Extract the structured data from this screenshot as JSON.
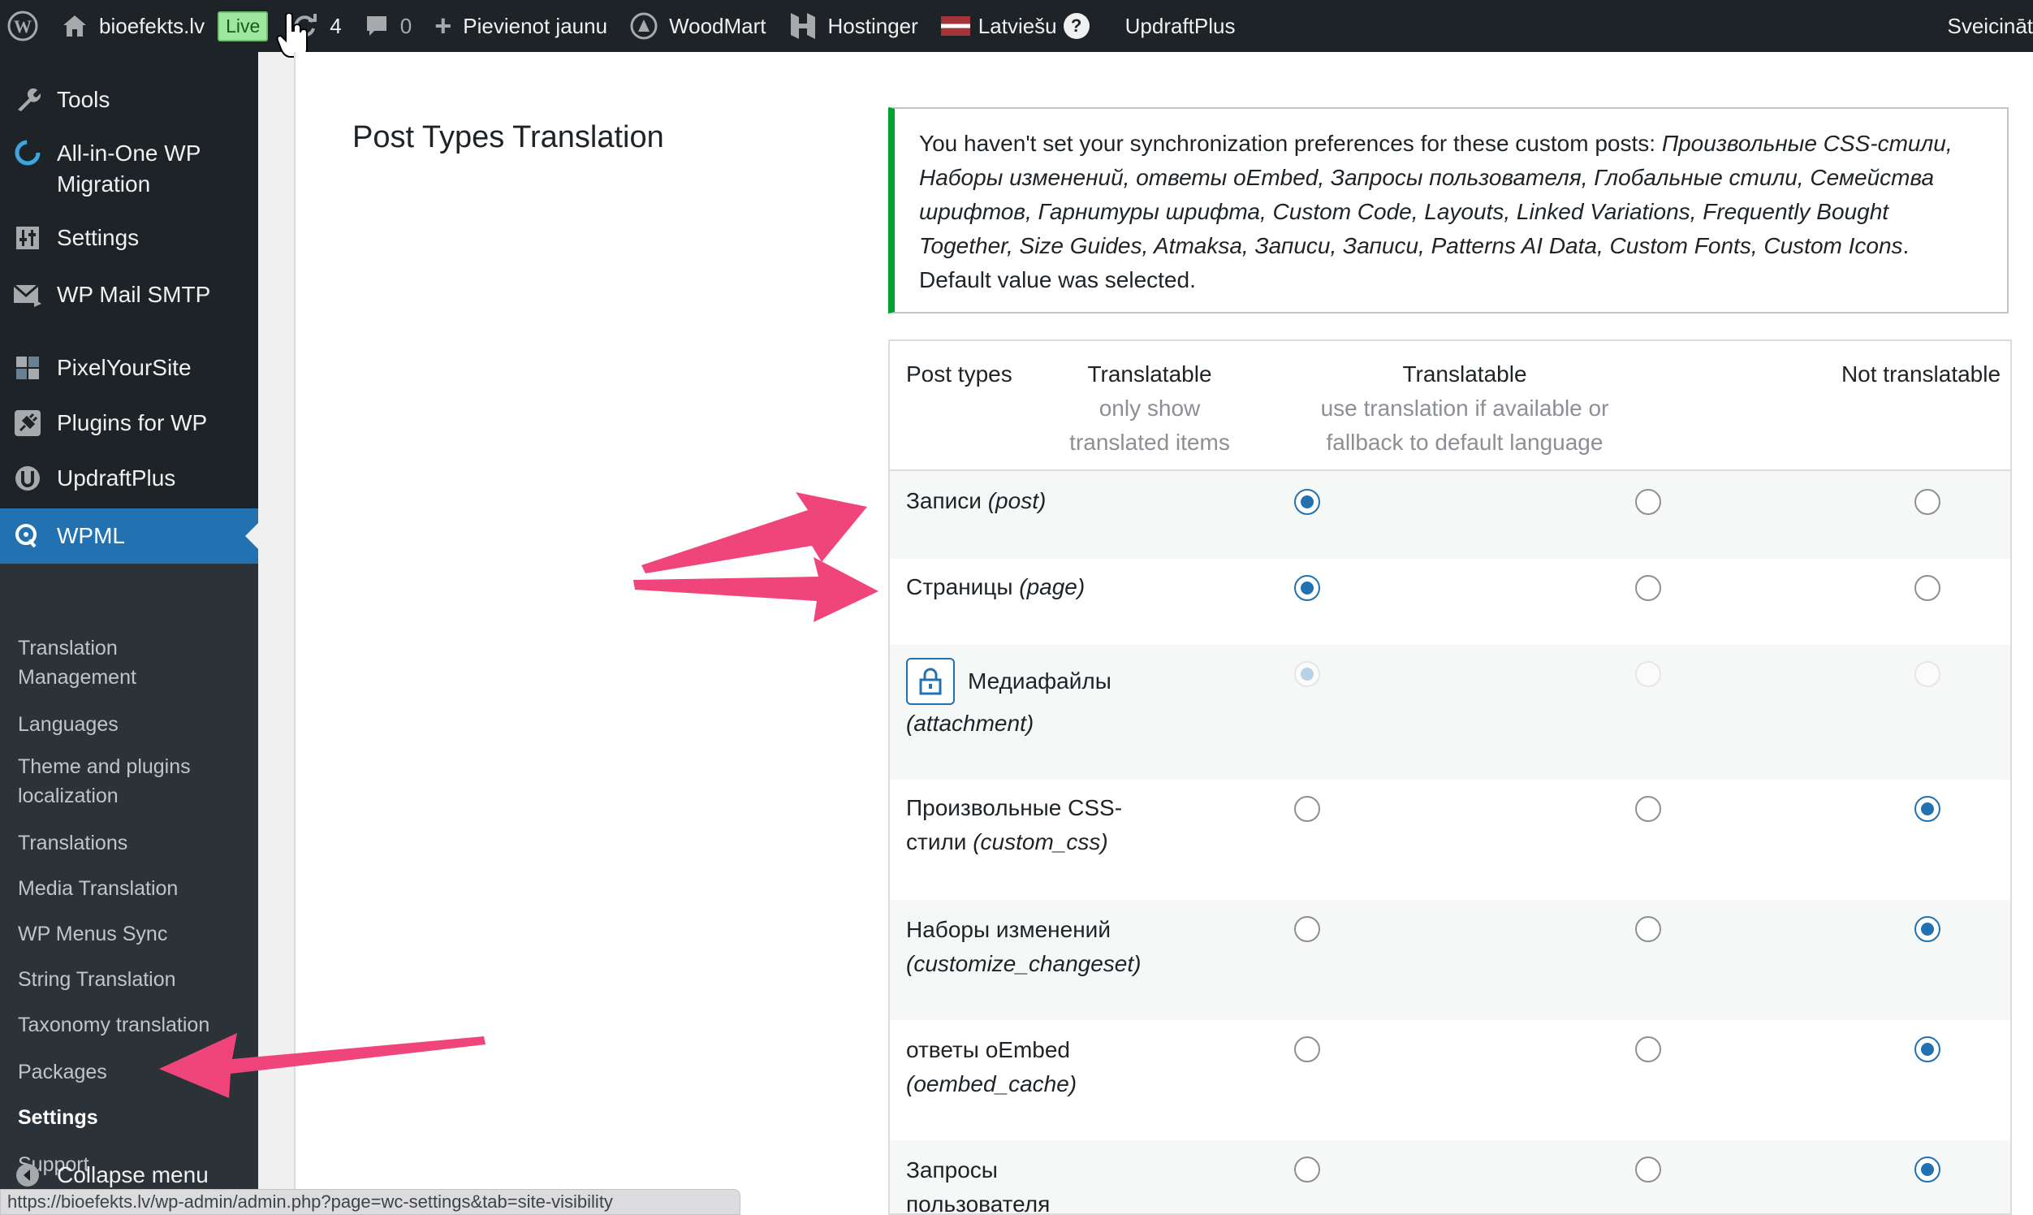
{
  "adminbar": {
    "site_name": "bioefekts.lv",
    "live_badge": "Live",
    "updates_count": "4",
    "comments_count": "0",
    "new_label": "Pievienot jaunu",
    "woodmart": "WoodMart",
    "hostinger": "Hostinger",
    "language": "Latviešu",
    "updraft": "UpdraftPlus",
    "greeting": "Sveicināt"
  },
  "sidebar": {
    "items": [
      {
        "label": "Tools",
        "icon": "wrench-icon"
      },
      {
        "label": "All-in-One WP Migration",
        "icon": "migration-icon"
      },
      {
        "label": "Settings",
        "icon": "settings-sliders-icon"
      },
      {
        "label": "WP Mail SMTP",
        "icon": "mail-icon"
      },
      {
        "label": "PixelYourSite",
        "icon": "pixel-icon"
      },
      {
        "label": "Plugins for WP",
        "icon": "plug-icon"
      },
      {
        "label": "UpdraftPlus",
        "icon": "updraft-icon"
      },
      {
        "label": "WPML",
        "icon": "wpml-icon"
      }
    ],
    "submenu": [
      "Translation Management",
      "Languages",
      "Theme and plugins localization",
      "Translations",
      "Media Translation",
      "WP Menus Sync",
      "String Translation",
      "Taxonomy translation",
      "Packages",
      "Settings",
      "Support"
    ],
    "collapse_label": "Collapse menu"
  },
  "main": {
    "page_title": "Post Types Translation",
    "notice": {
      "prefix": "You haven't set your synchronization preferences for these custom posts: ",
      "items": "Произвольные CSS-стили, Наборы изменений, ответы oEmbed, Запросы пользователя, Глобальные стили, Семейства шрифтов, Гарнитуры шрифта, Custom Code, Layouts, Linked Variations, Frequently Bought Together, Size Guides, Atmaksa, Записи, Записи, Patterns AI Data, Custom Fonts, Custom Icons",
      "suffix": ". Default value was selected."
    },
    "table": {
      "col_post_types": "Post types",
      "col_translatable_1": "Translatable",
      "col_translatable_1_sub": "only show translated items",
      "col_translatable_2": "Translatable",
      "col_translatable_2_sub": "use translation if available or fallback to default language",
      "col_not_translatable": "Not translatable",
      "rows": [
        {
          "name": "Записи",
          "slug": "(post)",
          "selected": 0
        },
        {
          "name": "Страницы",
          "slug": "(page)",
          "selected": 0
        },
        {
          "name": "Медиафайлы",
          "slug": "(attachment)",
          "selected": 0,
          "locked": true
        },
        {
          "name": "Произвольные CSS-стили",
          "slug": "(custom_css)",
          "selected": 2
        },
        {
          "name": "Наборы изменений",
          "slug": "(customize_changeset)",
          "selected": 2
        },
        {
          "name": "ответы oEmbed",
          "slug": "(oembed_cache)",
          "selected": 2
        },
        {
          "name": "Запросы пользователя",
          "slug": "",
          "selected": 2
        }
      ]
    }
  },
  "status_url": "https://bioefekts.lv/wp-admin/admin.php?page=wc-settings&tab=site-visibility",
  "colors": {
    "accent": "#2271b1",
    "notice_border": "#00a32a",
    "arrow": "#f0457a",
    "adminbar": "#1d2327"
  }
}
